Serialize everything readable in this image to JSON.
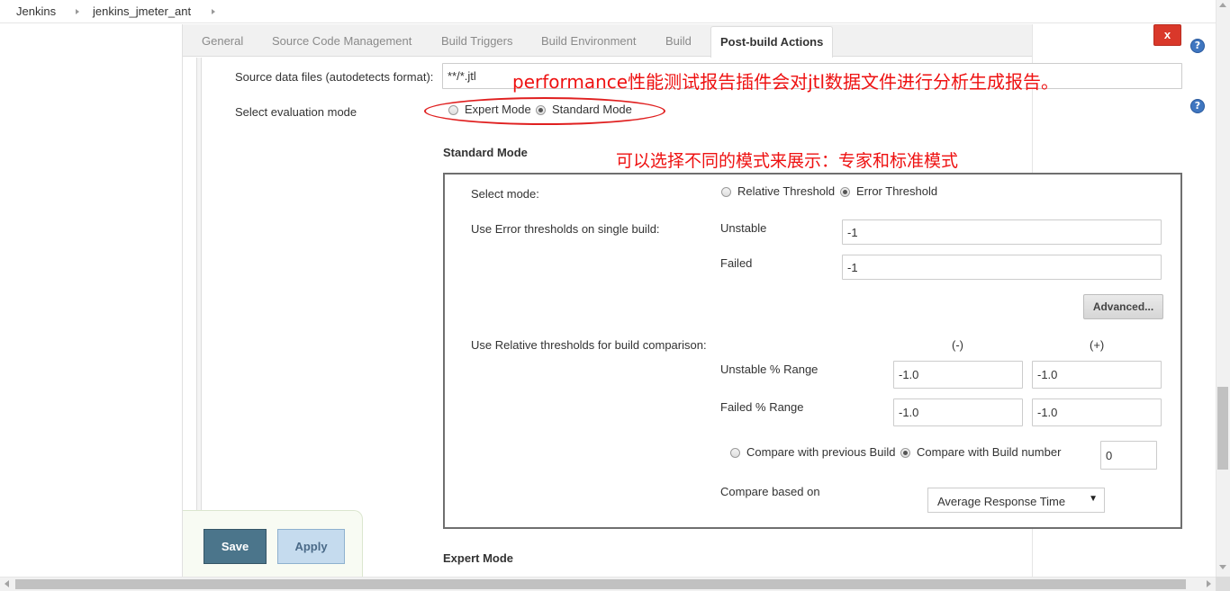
{
  "breadcrumb": {
    "items": [
      "Jenkins",
      "jenkins_jmeter_ant"
    ]
  },
  "tabs": [
    {
      "label": "General"
    },
    {
      "label": "Source Code Management"
    },
    {
      "label": "Build Triggers"
    },
    {
      "label": "Build Environment"
    },
    {
      "label": "Build"
    },
    {
      "label": "Post-build Actions",
      "active": true
    }
  ],
  "source_files": {
    "label": "Source data files (autodetects format):",
    "value": "**/*.jtl"
  },
  "evaluation_mode": {
    "label": "Select evaluation mode",
    "options": [
      "Expert Mode",
      "Standard Mode"
    ],
    "selected": "Standard Mode"
  },
  "annotations": {
    "plugin_note": "performance性能测试报告插件会对jtl数据文件进行分析生成报告。",
    "mode_note": "可以选择不同的模式来展示：专家和标准模式"
  },
  "standard_mode": {
    "title": "Standard Mode",
    "select_mode_label": "Select mode:",
    "select_mode_options": [
      "Relative Threshold",
      "Error Threshold"
    ],
    "select_mode_selected": "Error Threshold",
    "error_thresholds_label": "Use Error thresholds on single build:",
    "unstable_label": "Unstable",
    "unstable_value": "-1",
    "failed_label": "Failed",
    "failed_value": "-1",
    "advanced_label": "Advanced...",
    "relative_label": "Use Relative thresholds for build comparison:",
    "minus_header": "(-)",
    "plus_header": "(+)",
    "unstable_range_label": "Unstable % Range",
    "unstable_range_minus": "-1.0",
    "unstable_range_plus": "-1.0",
    "failed_range_label": "Failed % Range",
    "failed_range_minus": "-1.0",
    "failed_range_plus": "-1.0",
    "compare_options": [
      "Compare with previous Build",
      "Compare with Build number"
    ],
    "compare_selected": "Compare with Build number",
    "build_number": "0",
    "compare_based_label": "Compare based on",
    "compare_based_value": "Average Response Time"
  },
  "expert_mode": {
    "title": "Expert Mode"
  },
  "buttons": {
    "delete": "x",
    "save": "Save",
    "apply": "Apply"
  },
  "icons": {
    "help": "?",
    "dropdown": "▼"
  },
  "colors": {
    "annotation": "#ee1111",
    "save_button": "#4b758b",
    "apply_button": "#c5dbee",
    "delete_button": "#d9382a",
    "help_icon": "#3f76c0"
  }
}
